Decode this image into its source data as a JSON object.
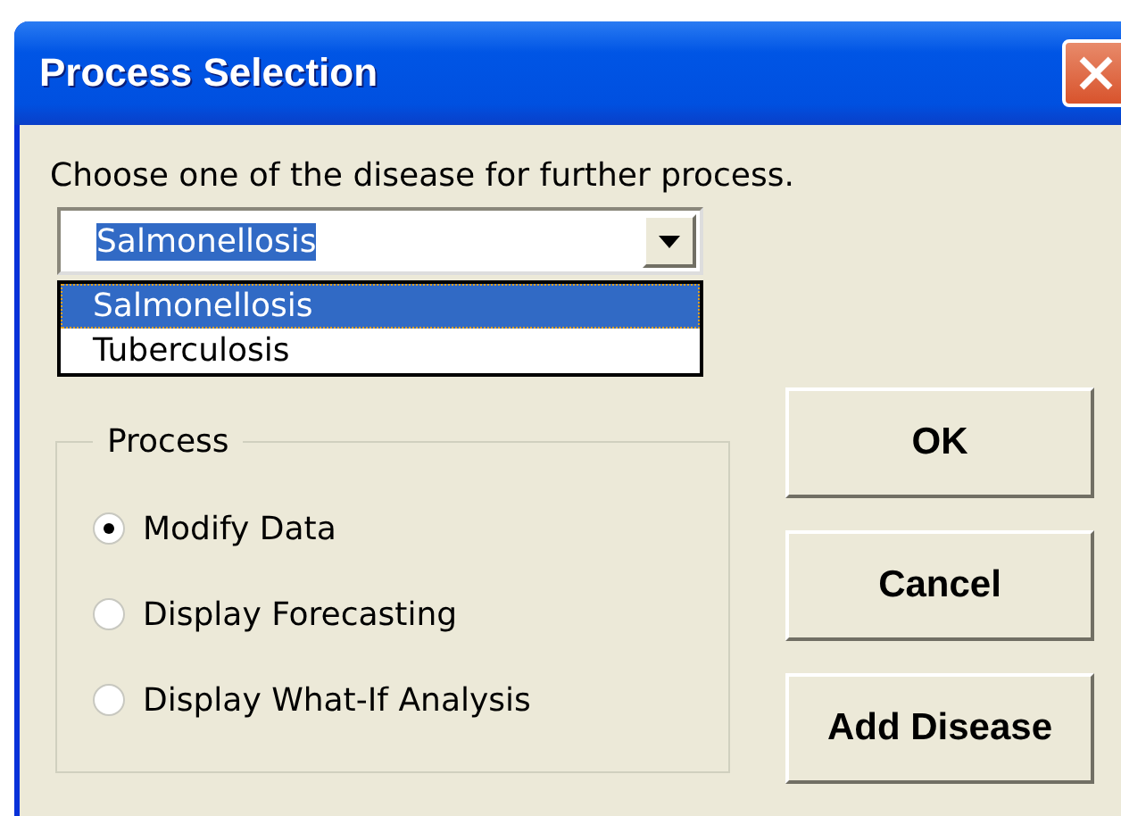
{
  "window": {
    "title": "Process Selection"
  },
  "prompt": "Choose one of the disease for further process.",
  "combo": {
    "value": "Salmonellosis",
    "options": [
      {
        "label": "Salmonellosis",
        "selected": true
      },
      {
        "label": "Tuberculosis",
        "selected": false
      }
    ]
  },
  "process_group": {
    "title": "Process",
    "options": [
      {
        "label": "Modify Data",
        "selected": true
      },
      {
        "label": "Display Forecasting",
        "selected": false
      },
      {
        "label": "Display What-If Analysis",
        "selected": false
      }
    ]
  },
  "buttons": [
    "OK",
    "Cancel",
    "Add Disease"
  ]
}
